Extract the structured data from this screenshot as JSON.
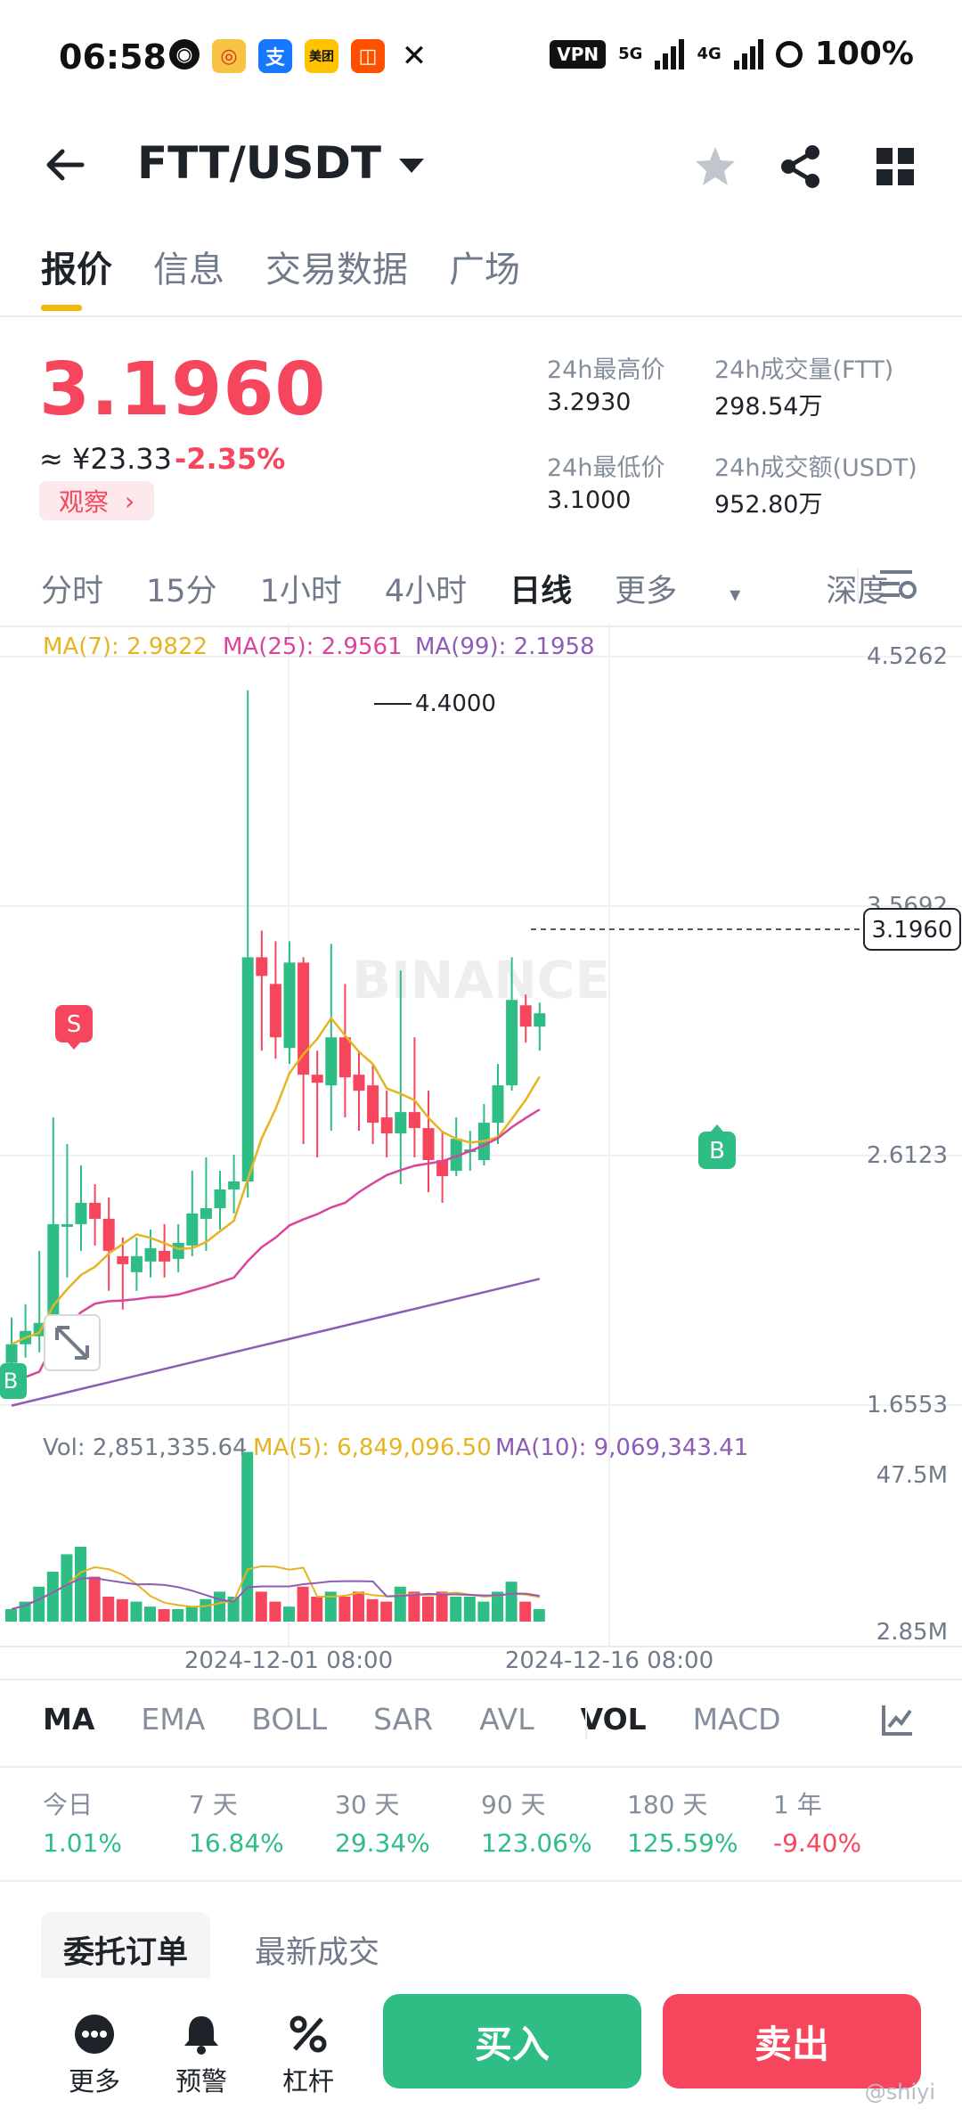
{
  "status_bar": {
    "time": "06:58",
    "vpn": "VPN",
    "net1": "5G",
    "net2": "4G",
    "battery": "100%",
    "apps": [
      "wechat-icon",
      "weibo-icon",
      "alipay-icon",
      "meituan-icon",
      "taobao-icon",
      "x-icon"
    ]
  },
  "header": {
    "pair": "FTT/USDT"
  },
  "tabs": [
    "报价",
    "信息",
    "交易数据",
    "广场"
  ],
  "ticker": {
    "price": "3.1960",
    "cny": "≈ ¥23.33",
    "change": "-2.35%",
    "watch_label": "观察",
    "high_label": "24h最高价",
    "high": "3.2930",
    "low_label": "24h最低价",
    "low": "3.1000",
    "vol_ftt_label": "24h成交量(FTT)",
    "vol_ftt": "298.54万",
    "vol_usdt_label": "24h成交额(USDT)",
    "vol_usdt": "952.80万"
  },
  "intervals": {
    "items": [
      "分时",
      "15分",
      "1小时",
      "4小时",
      "日线"
    ],
    "more": "更多",
    "depth": "深度"
  },
  "chart_data": {
    "type": "candlestick",
    "ma_labels": [
      "MA(7): 2.9822",
      "MA(25): 2.9561",
      "MA(99): 2.1958"
    ],
    "y_axis": [
      "4.5262",
      "3.5692",
      "2.6123",
      "1.6553"
    ],
    "ylim": [
      1.6553,
      4.5262
    ],
    "high_marker": "4.4000",
    "current_price": "3.1960",
    "vol_labels": [
      "Vol: 2,851,335.64",
      "MA(5): 6,849,096.50",
      "MA(10): 9,069,343.41"
    ],
    "vol_axis": [
      "47.5M",
      "2.85M"
    ],
    "x_labels": [
      "2024-12-01 08:00",
      "2024-12-16 08:00"
    ],
    "watermark": "BINANCE",
    "marker_s": "S",
    "marker_b": "B",
    "colors": {
      "up": "#2ebd85",
      "down": "#f6465d",
      "ma7": "#e6b422",
      "ma25": "#d9449c",
      "ma99": "#8e5cb5"
    }
  },
  "indicators": {
    "main": [
      "MA",
      "EMA",
      "BOLL",
      "SAR",
      "AVL"
    ],
    "sub": [
      "VOL",
      "MACD"
    ]
  },
  "performance": [
    {
      "label": "今日",
      "value": "1.01%",
      "dir": "up"
    },
    {
      "label": "7 天",
      "value": "16.84%",
      "dir": "up"
    },
    {
      "label": "30 天",
      "value": "29.34%",
      "dir": "up"
    },
    {
      "label": "90 天",
      "value": "123.06%",
      "dir": "up"
    },
    {
      "label": "180 天",
      "value": "125.59%",
      "dir": "up"
    },
    {
      "label": "1 年",
      "value": "-9.40%",
      "dir": "down"
    }
  ],
  "order_tabs": [
    "委托订单",
    "最新成交"
  ],
  "bottom": {
    "more": "更多",
    "alert": "预警",
    "leverage": "杠杆",
    "buy": "买入",
    "sell": "卖出"
  },
  "watermark_user": "@shiyi"
}
